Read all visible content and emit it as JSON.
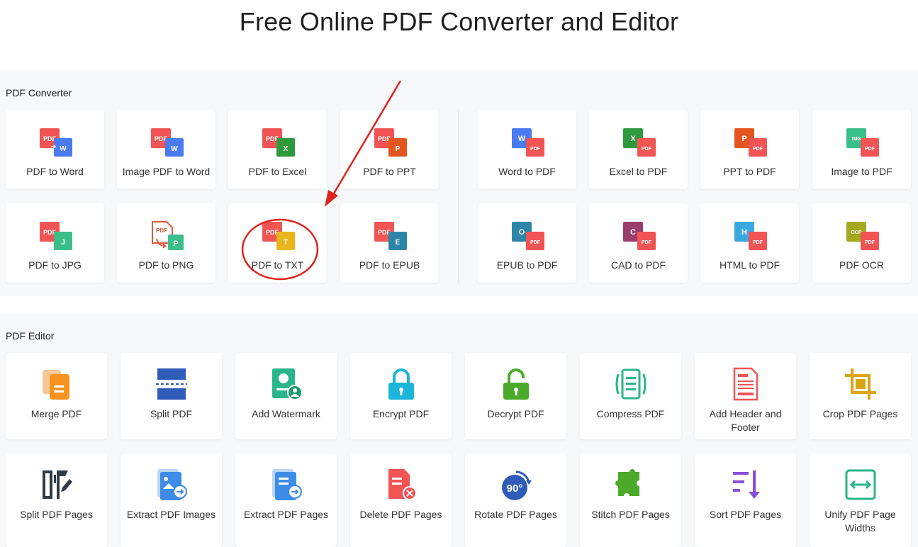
{
  "page": {
    "title": "Free Online PDF Converter and Editor"
  },
  "converter": {
    "label": "PDF Converter",
    "items": [
      {
        "label": "PDF to Word"
      },
      {
        "label": "Image PDF to Word"
      },
      {
        "label": "PDF to Excel"
      },
      {
        "label": "PDF to PPT"
      },
      {
        "label": "Word to PDF"
      },
      {
        "label": "Excel to PDF"
      },
      {
        "label": "PPT to PDF"
      },
      {
        "label": "Image to PDF"
      },
      {
        "label": "PDF to JPG"
      },
      {
        "label": "PDF to PNG"
      },
      {
        "label": "PDF to TXT"
      },
      {
        "label": "PDF to EPUB"
      },
      {
        "label": "EPUB to PDF"
      },
      {
        "label": "CAD to PDF"
      },
      {
        "label": "HTML to PDF"
      },
      {
        "label": "PDF OCR"
      }
    ]
  },
  "editor": {
    "label": "PDF Editor",
    "items": [
      {
        "label": "Merge PDF"
      },
      {
        "label": "Split PDF"
      },
      {
        "label": "Add Watermark"
      },
      {
        "label": "Encrypt PDF"
      },
      {
        "label": "Decrypt PDF"
      },
      {
        "label": "Compress PDF"
      },
      {
        "label": "Add Header and Footer"
      },
      {
        "label": "Crop PDF Pages"
      },
      {
        "label": "Split PDF Pages"
      },
      {
        "label": "Extract PDF Images"
      },
      {
        "label": "Extract PDF Pages"
      },
      {
        "label": "Delete PDF Pages"
      },
      {
        "label": "Rotate PDF Pages"
      },
      {
        "label": "Stitch PDF Pages"
      },
      {
        "label": "Sort PDF Pages"
      },
      {
        "label": "Unify PDF Page Widths"
      }
    ]
  },
  "icon_text": {
    "pdf": "PDF",
    "w": "W",
    "x": "X",
    "p": "P",
    "j": "J",
    "t": "T",
    "e": "E",
    "o": "O",
    "c": "C",
    "h": "H",
    "img": "IMG",
    "ocr": "OCR",
    "rotate": "90°"
  },
  "colors": {
    "pdf_red": "#f05454",
    "word_blue": "#4a7bf0",
    "excel_green": "#2e9a3c",
    "ppt_orange": "#e3561f",
    "jpg_green": "#3bbf8a",
    "txt_yellow": "#e8b51a",
    "epub_teal": "#2d86a8",
    "annotation_red": "#e0231c"
  },
  "annotation": {
    "type": "arrow-and-circle",
    "target": "PDF to TXT"
  }
}
